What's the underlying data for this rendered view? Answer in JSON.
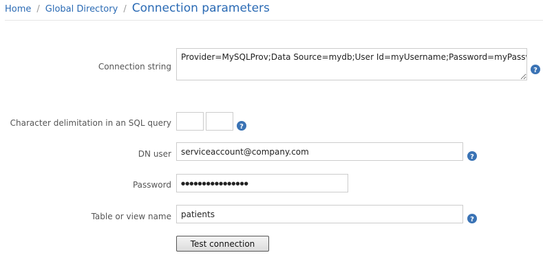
{
  "breadcrumb": {
    "home": "Home",
    "separator": "/",
    "global_directory": "Global Directory",
    "current": "Connection parameters"
  },
  "form": {
    "connection_string": {
      "label": "Connection string",
      "value": "Provider=MySQLProv;Data Source=mydb;User Id=myUsername;Password=myPassword;",
      "help_icon": "question-circle-icon"
    },
    "char_delimitation": {
      "label": "Character delimitation in an SQL query",
      "start_value": "",
      "end_value": "",
      "help_icon": "question-circle-icon"
    },
    "dn_user": {
      "label": "DN user",
      "value": "serviceaccount@company.com",
      "help_icon": "question-circle-icon"
    },
    "password": {
      "label": "Password",
      "value": "●●●●●●●●●●●●●●●●"
    },
    "table_name": {
      "label": "Table or view name",
      "value": "patients",
      "help_icon": "question-circle-icon"
    },
    "test_button_label": "Test connection"
  },
  "colors": {
    "link": "#2a6ab4",
    "help_icon": "#3a73b5"
  }
}
